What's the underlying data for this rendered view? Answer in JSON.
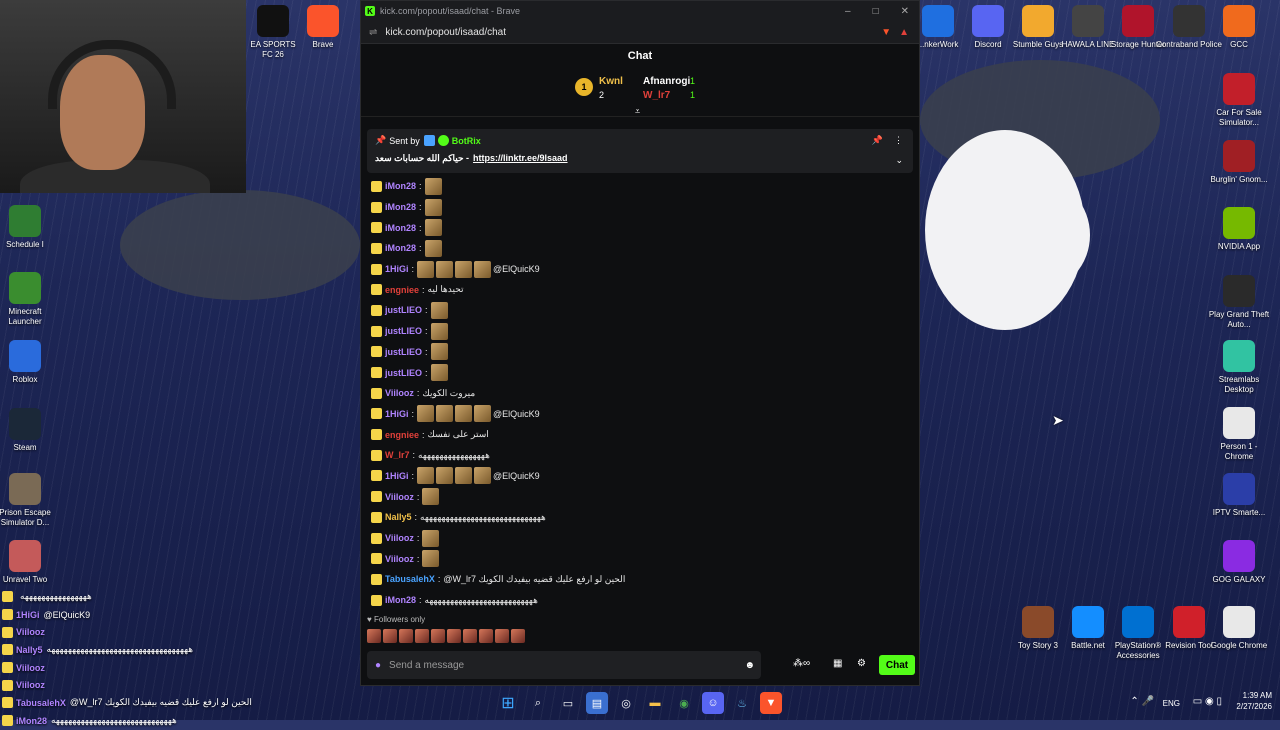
{
  "browser": {
    "title": "kick.com/popout/isaad/chat - Brave",
    "url": "kick.com/popout/isaad/chat",
    "tab_label": "K"
  },
  "chat": {
    "header": "Chat",
    "leaderboard": {
      "rank": "1",
      "left_user": "Kwnl",
      "left_count": "2",
      "top": [
        {
          "name": "Afnanrogi",
          "count": "1"
        },
        {
          "name": "W_lr7",
          "count": "1"
        }
      ]
    },
    "pinned": {
      "sent_by": "Sent by",
      "bot": "BotRix",
      "text": "حياكم الله حسابات سعد -",
      "link": "https://linktr.ee/9lsaad"
    },
    "messages": [
      {
        "user": "iMon28",
        "color": "#b084ff",
        "text": "",
        "emotes": 1
      },
      {
        "user": "iMon28",
        "color": "#b084ff",
        "text": "",
        "emotes": 1
      },
      {
        "user": "iMon28",
        "color": "#b084ff",
        "text": "",
        "emotes": 1
      },
      {
        "user": "iMon28",
        "color": "#b084ff",
        "text": "",
        "emotes": 1
      },
      {
        "user": "1HiGi",
        "color": "#b084ff",
        "text": "@ElQuicK9",
        "emotes": 4
      },
      {
        "user": "engniee",
        "color": "#e0403a",
        "text": "تحيدها ليه",
        "emotes": 0
      },
      {
        "user": "justLIEO",
        "color": "#b084ff",
        "text": "",
        "emotes": 1
      },
      {
        "user": "justLIEO",
        "color": "#b084ff",
        "text": "",
        "emotes": 1
      },
      {
        "user": "justLIEO",
        "color": "#b084ff",
        "text": "",
        "emotes": 1
      },
      {
        "user": "justLIEO",
        "color": "#b084ff",
        "text": "",
        "emotes": 1
      },
      {
        "user": "Viilooz",
        "color": "#b084ff",
        "text": "ميروت الكويك",
        "emotes": 0
      },
      {
        "user": "1HiGi",
        "color": "#b084ff",
        "text": "@ElQuicK9",
        "emotes": 4
      },
      {
        "user": "engniee",
        "color": "#e0403a",
        "text": "استر على نفسك",
        "emotes": 0
      },
      {
        "user": "W_lr7",
        "color": "#e0403a",
        "text": "ههههههههههههههههه",
        "emotes": 0
      },
      {
        "user": "1HiGi",
        "color": "#b084ff",
        "text": "@ElQuicK9",
        "emotes": 4
      },
      {
        "user": "Viilooz",
        "color": "#b084ff",
        "text": "",
        "emotes": 1
      },
      {
        "user": "Nally5",
        "color": "#f0c04a",
        "text": "هههههههههههههههههههههههههههههه",
        "emotes": 0
      },
      {
        "user": "Viilooz",
        "color": "#b084ff",
        "text": "",
        "emotes": 1
      },
      {
        "user": "Viilooz",
        "color": "#b084ff",
        "text": "",
        "emotes": 1
      },
      {
        "user": "TabusalehX",
        "color": "#4aa3ff",
        "text": "@W_lr7 الحين لو ارفع عليك قضيه بيفيدك الكويك",
        "emotes": 0
      },
      {
        "user": "iMon28",
        "color": "#b084ff",
        "text": "ههههههههههههههههههههههههههه",
        "emotes": 0
      }
    ],
    "followers_only": "Followers only",
    "input_placeholder": "Send a message",
    "send_label": "Chat"
  },
  "overlay": [
    {
      "user": "",
      "text": "ههههههههههههههههه"
    },
    {
      "user": "1HiGi",
      "text": "@ElQuicK9"
    },
    {
      "user": "Viilooz",
      "text": ""
    },
    {
      "user": "Nally5",
      "text": "ههههههههههههههههههههههههههههههههههه"
    },
    {
      "user": "Viilooz",
      "text": ""
    },
    {
      "user": "Viilooz",
      "text": ""
    },
    {
      "user": "TabusalehX",
      "text": "@W_lr7 الحين لو ارفع عليك قضيه بيفيدك الكويك"
    },
    {
      "user": "iMon28",
      "text": "هههههههههههههههههههههههههههههه"
    }
  ],
  "desktop_left": [
    {
      "label": "EA SPORTS FC 26",
      "color": "#111"
    },
    {
      "label": "Brave",
      "color": "#fb542b"
    },
    {
      "label": "Schedule I",
      "color": "#2f7d32"
    },
    {
      "label": "Minecraft Launcher",
      "color": "#3a8d2f"
    },
    {
      "label": "Roblox",
      "color": "#2a6bdc"
    },
    {
      "label": "Steam",
      "color": "#1b2838"
    },
    {
      "label": "Prison Escape Simulator D...",
      "color": "#7a6a55"
    },
    {
      "label": "Unravel Two",
      "color": "#c45a5a"
    }
  ],
  "desktop_right": [
    {
      "label": "...nkerWork",
      "color": "#1f6fe0"
    },
    {
      "label": "Discord",
      "color": "#5865f2"
    },
    {
      "label": "Stumble Guys",
      "color": "#f2a92e"
    },
    {
      "label": "HAWALA LINE",
      "color": "#444"
    },
    {
      "label": "Storage Hunter",
      "color": "#b0142b"
    },
    {
      "label": "Contraband Police",
      "color": "#333"
    },
    {
      "label": "GCC",
      "color": "#f06a1d"
    },
    {
      "label": "Car For Sale Simulator...",
      "color": "#c21f2a"
    },
    {
      "label": "Burglin' Gnom...",
      "color": "#a01f24"
    },
    {
      "label": "NVIDIA App",
      "color": "#76b900"
    },
    {
      "label": "Play Grand Theft Auto...",
      "color": "#2a2a2a"
    },
    {
      "label": "Streamlabs Desktop",
      "color": "#31c3a2"
    },
    {
      "label": "Person 1 - Chrome",
      "color": "#e8e8e8"
    },
    {
      "label": "IPTV Smarte...",
      "color": "#2b3ea8"
    },
    {
      "label": "GOG GALAXY",
      "color": "#8a2be2"
    },
    {
      "label": "Toy Story 3",
      "color": "#8a4a2a"
    },
    {
      "label": "Battle.net",
      "color": "#148eff"
    },
    {
      "label": "PlayStation® Accessories",
      "color": "#0070d1"
    },
    {
      "label": "Revision Tool",
      "color": "#d0202a"
    },
    {
      "label": "Google Chrome",
      "color": "#e8e8e8"
    }
  ],
  "tray": {
    "lang": "ENG",
    "time": "1:39 AM",
    "date": "2/27/2026"
  }
}
